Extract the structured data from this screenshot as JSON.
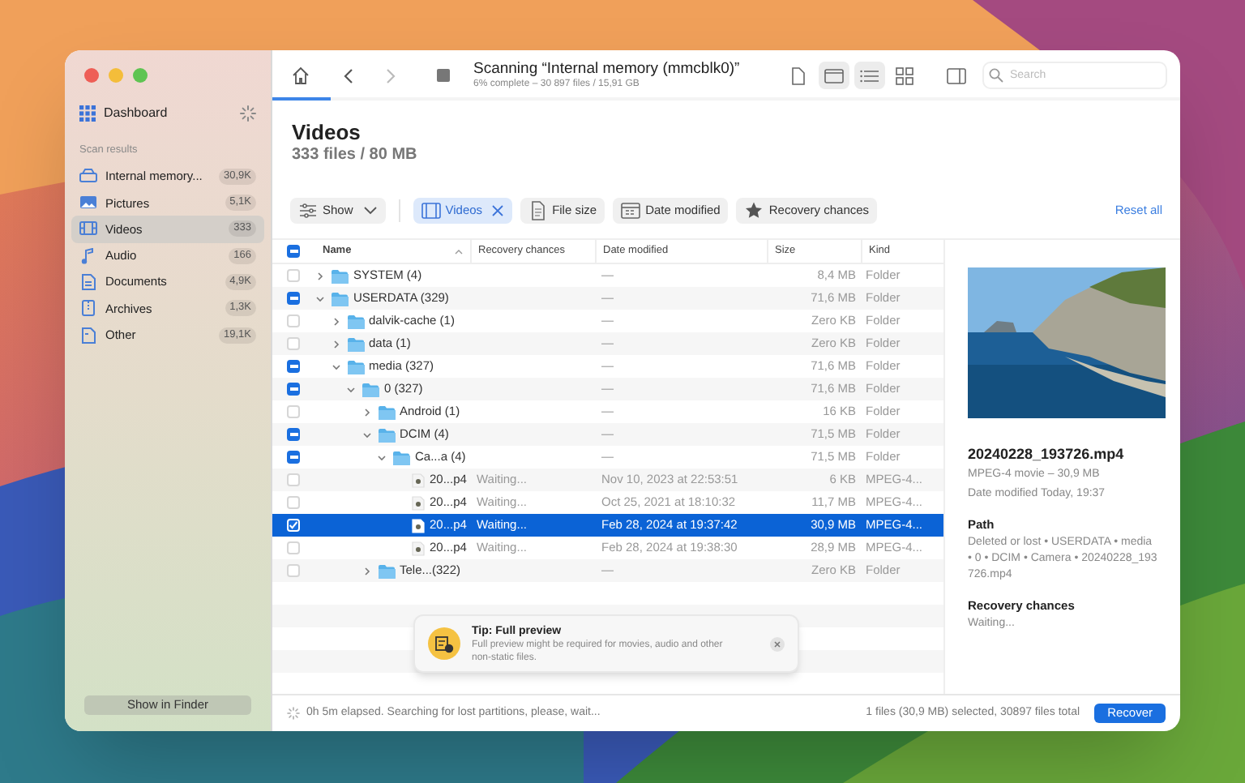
{
  "sidebar": {
    "dashboard": "Dashboard",
    "section": "Scan results",
    "items": [
      {
        "kind": "drive",
        "label": "Internal memory...",
        "count": "30,9K",
        "selected": false
      },
      {
        "kind": "pictures",
        "label": "Pictures",
        "count": "5,1K",
        "selected": false
      },
      {
        "kind": "videos",
        "label": "Videos",
        "count": "333",
        "selected": true
      },
      {
        "kind": "audio",
        "label": "Audio",
        "count": "166",
        "selected": false
      },
      {
        "kind": "documents",
        "label": "Documents",
        "count": "4,9K",
        "selected": false
      },
      {
        "kind": "archives",
        "label": "Archives",
        "count": "1,3K",
        "selected": false
      },
      {
        "kind": "other",
        "label": "Other",
        "count": "19,1K",
        "selected": false
      }
    ],
    "footer_button": "Show in Finder"
  },
  "toolbar": {
    "title": "Scanning “Internal memory (mmcblk0)”",
    "subtitle": "6% complete – 30 897 files / 15,91 GB",
    "progress": {
      "level": 0.065
    },
    "views": [
      {
        "kind": "file",
        "selected": false
      },
      {
        "kind": "folder",
        "selected": true
      },
      {
        "kind": "list",
        "selected": true
      },
      {
        "kind": "grid",
        "selected": false
      }
    ],
    "search": {
      "placeholder": "Search"
    }
  },
  "header": {
    "title": "Videos",
    "subtitle": "333 files / 80 MB"
  },
  "filters": [
    {
      "kind": "menu",
      "label": "Show"
    },
    {
      "kind": "applied",
      "label": "Videos"
    },
    {
      "kind": "filter",
      "label": "File size"
    },
    {
      "kind": "filter",
      "label": "Date modified"
    },
    {
      "kind": "filter",
      "label": "Recovery chances"
    }
  ],
  "reset": "Reset all",
  "table": {
    "header_checkbox": {
      "indeterminate": true
    },
    "columns": [
      "Name",
      "Recovery chances",
      "Date modified",
      "Size",
      "Kind"
    ],
    "rows": [
      {
        "kind": "folder",
        "name": "SYSTEM (4)",
        "checked": false,
        "expanded": false,
        "date": "—",
        "size": "8,4 MB",
        "type": "Folder",
        "selected": false
      },
      {
        "kind": "folder",
        "name": "USERDATA (329)",
        "indeterminate": true,
        "expanded": true,
        "date": "—",
        "size": "71,6 MB",
        "type": "Folder",
        "selected": false,
        "children": [
          {
            "kind": "folder",
            "name": "dalvik-cache (1)",
            "checked": false,
            "expanded": false,
            "date": "—",
            "size": "Zero KB",
            "type": "Folder",
            "selected": false
          },
          {
            "kind": "folder",
            "name": "data (1)",
            "checked": false,
            "expanded": false,
            "date": "—",
            "size": "Zero KB",
            "type": "Folder",
            "selected": false
          },
          {
            "kind": "folder",
            "name": "media (327)",
            "indeterminate": true,
            "expanded": true,
            "date": "—",
            "size": "71,6 MB",
            "type": "Folder",
            "selected": false,
            "children": [
              {
                "kind": "folder",
                "name": "0 (327)",
                "indeterminate": true,
                "expanded": true,
                "date": "—",
                "size": "71,6 MB",
                "type": "Folder",
                "selected": false,
                "children": [
                  {
                    "kind": "folder",
                    "name": "Android (1)",
                    "checked": false,
                    "expanded": false,
                    "date": "—",
                    "size": "16 KB",
                    "type": "Folder",
                    "selected": false
                  },
                  {
                    "kind": "folder",
                    "name": "DCIM (4)",
                    "indeterminate": true,
                    "expanded": true,
                    "date": "—",
                    "size": "71,5 MB",
                    "type": "Folder",
                    "selected": false,
                    "children": [
                      {
                        "kind": "folder",
                        "name": "Ca...a (4)",
                        "indeterminate": true,
                        "expanded": true,
                        "date": "—",
                        "size": "71,5 MB",
                        "type": "Folder",
                        "selected": false,
                        "children": [
                          {
                            "kind": "file",
                            "name": "20...p4",
                            "checked": false,
                            "recovery": "Waiting...",
                            "date": "Nov 10, 2023 at 22:53:51",
                            "size": "6 KB",
                            "type": "MPEG-4...",
                            "selected": false
                          },
                          {
                            "kind": "file",
                            "name": "20...p4",
                            "checked": false,
                            "recovery": "Waiting...",
                            "date": "Oct 25, 2021 at 18:10:32",
                            "size": "11,7 MB",
                            "type": "MPEG-4...",
                            "selected": false
                          },
                          {
                            "kind": "file",
                            "name": "20...p4",
                            "checked": true,
                            "recovery": "Waiting...",
                            "date": "Feb 28, 2024 at 19:37:42",
                            "size": "30,9 MB",
                            "type": "MPEG-4...",
                            "selected": true
                          },
                          {
                            "kind": "file",
                            "name": "20...p4",
                            "checked": false,
                            "recovery": "Waiting...",
                            "date": "Feb 28, 2024 at 19:38:30",
                            "size": "28,9 MB",
                            "type": "MPEG-4...",
                            "selected": false
                          }
                        ]
                      }
                    ]
                  },
                  {
                    "kind": "folder",
                    "name": "Tele...(322)",
                    "checked": false,
                    "expanded": false,
                    "date": "—",
                    "size": "Zero KB",
                    "type": "Folder",
                    "selected": false
                  }
                ]
              }
            ]
          }
        ]
      }
    ]
  },
  "preview": {
    "filename": "20240228_193726.mp4",
    "info": [
      "MPEG-4 movie – 30,9 MB",
      "Date modified Today, 19:37"
    ],
    "sections": [
      {
        "heading": "Path",
        "text": "Deleted or lost • USERDATA • media • 0 • DCIM • Camera • 20240228_193726.mp4"
      },
      {
        "heading": "Recovery chances",
        "text": "Waiting..."
      }
    ]
  },
  "tip": {
    "title": "Tip: Full preview",
    "text": "Full preview might be required for movies, audio and other non-static files."
  },
  "status_bar": {
    "message": "0h 5m elapsed. Searching for lost partitions, please, wait...",
    "selection": "1 files (30,9 MB) selected, 30897 files total",
    "button": "Recover"
  }
}
